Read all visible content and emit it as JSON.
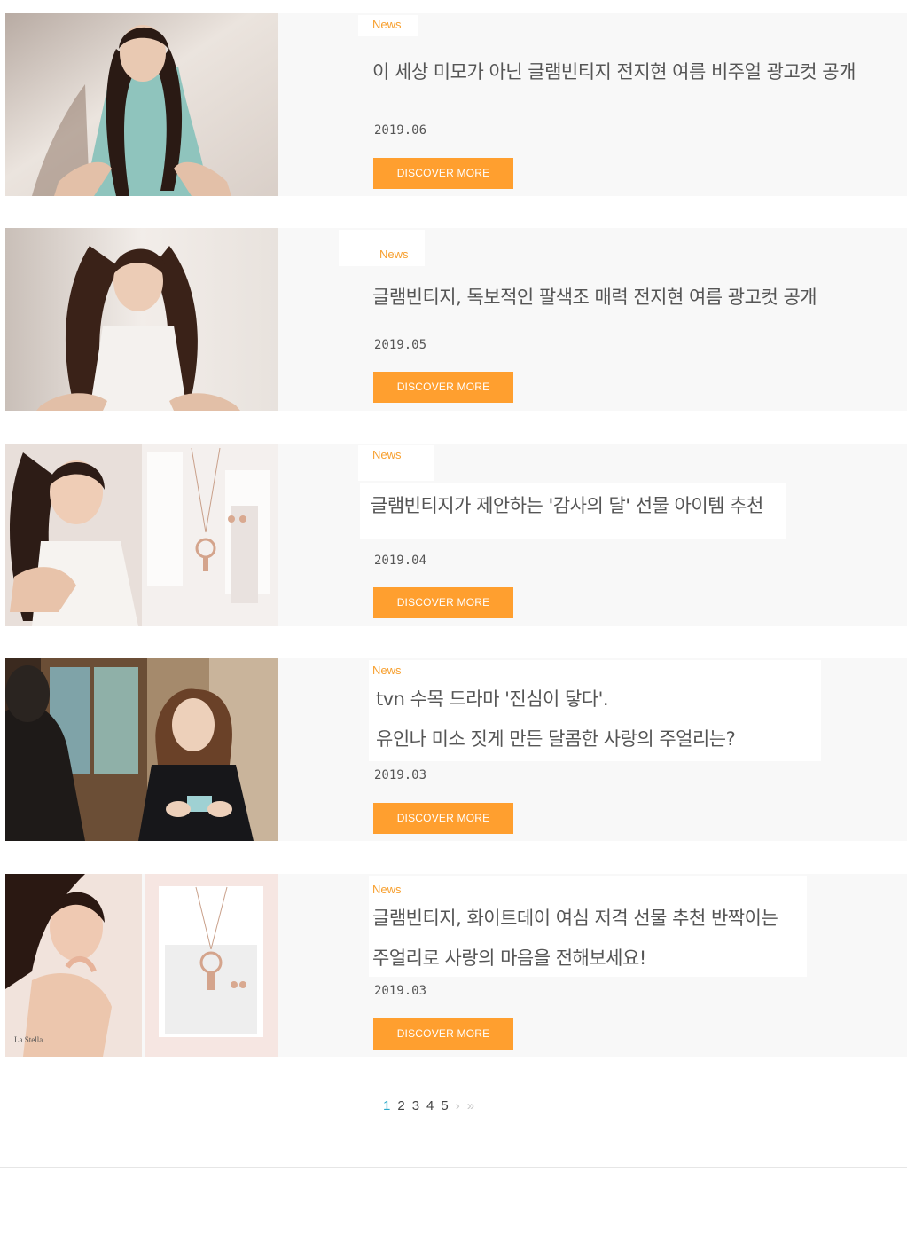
{
  "articles": [
    {
      "tag": "News",
      "title_lines": [
        "이 세상 미모가 아닌 글램빈티지 전지현 여름 비주얼 광고컷 공개"
      ],
      "date": "2019.06",
      "button": "DISCOVER MORE"
    },
    {
      "tag": "News",
      "title_lines": [
        "글램빈티지, 독보적인 팔색조 매력 전지현 여름 광고컷 공개"
      ],
      "date": "2019.05",
      "button": "DISCOVER MORE"
    },
    {
      "tag": "News",
      "title_lines": [
        "글램빈티지가 제안하는 '감사의 달' 선물 아이템 추천"
      ],
      "date": "2019.04",
      "button": "DISCOVER MORE"
    },
    {
      "tag": "News",
      "title_lines": [
        "tvn 수목 드라마 '진심이 닿다'.",
        "유인나 미소 짓게 만든 달콤한 사랑의 주얼리는?"
      ],
      "date": "2019.03",
      "button": "DISCOVER MORE"
    },
    {
      "tag": "News",
      "title_lines": [
        "글램빈티지, 화이트데이 여심 저격 선물 추천 반짝이는",
        "주얼리로 사랑의 마음을 전해보세요!"
      ],
      "date": "2019.03",
      "button": "DISCOVER MORE",
      "image_caption": "La Stella"
    }
  ],
  "pagination": {
    "pages": [
      "1",
      "2",
      "3",
      "4",
      "5"
    ],
    "active": "1",
    "next": "›",
    "last": "»"
  },
  "colors": {
    "accent": "#ff9f2f",
    "tag": "#f7a030",
    "active_page": "#2aa8c9",
    "card_bg": "#f8f8f8"
  }
}
